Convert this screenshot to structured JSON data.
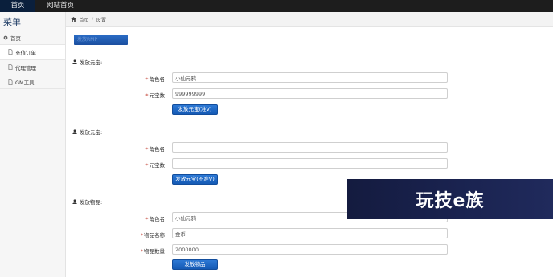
{
  "topnav": {
    "items": [
      {
        "label": "首页",
        "active": true
      },
      {
        "label": "网站首页",
        "active": false
      }
    ]
  },
  "sidebar": {
    "title": "菜单",
    "group_label": "首页",
    "items": [
      {
        "label": "充值订单",
        "icon": "file-icon",
        "active": true
      },
      {
        "label": "代理管理",
        "icon": "file-icon",
        "active": false
      },
      {
        "label": "GM工具",
        "icon": "file-icon",
        "active": false
      }
    ]
  },
  "breadcrumb": {
    "home_label": "首页",
    "current": "设置"
  },
  "toolbar": {
    "blue_button_label": "发放RMP"
  },
  "sections": [
    {
      "title": "发放元宝:",
      "fields": [
        {
          "label": "角色名",
          "value": "小仙元鸦",
          "placeholder": ""
        },
        {
          "label": "元宝数",
          "value": "999999999",
          "placeholder": ""
        }
      ],
      "button_label": "发放元宝(准V)"
    },
    {
      "title": "发放元宝:",
      "fields": [
        {
          "label": "角色名",
          "value": "",
          "placeholder": ""
        },
        {
          "label": "元宝数",
          "value": "",
          "placeholder": ""
        }
      ],
      "button_label": "发放元宝(不准V)"
    },
    {
      "title": "发放物品:",
      "fields": [
        {
          "label": "角色名",
          "value": "小仙元鸦",
          "placeholder": ""
        },
        {
          "label": "物品名称",
          "value": "金币",
          "placeholder": ""
        },
        {
          "label": "物品数量",
          "value": "2000000",
          "placeholder": ""
        }
      ],
      "button_label": "发放物品"
    }
  ],
  "watermark": {
    "text": "玩技e族"
  },
  "colors": {
    "topbar": "#1d1d1d",
    "active_tab": "#0a1f3c",
    "button": "#155ab5",
    "required": "#c0392b"
  }
}
